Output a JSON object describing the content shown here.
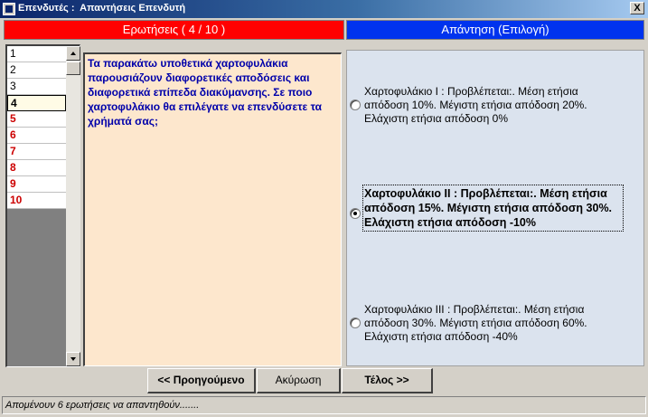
{
  "window": {
    "title": "Επενδυτές :  Απαντήσεις Επενδυτή",
    "close_label": "X"
  },
  "questions_header": "Ερωτήσεις ( 4 / 10 )",
  "answer_header": "Απάντηση (Επιλογή)",
  "question_list": [
    {
      "label": "1",
      "state": "normal"
    },
    {
      "label": "2",
      "state": "normal"
    },
    {
      "label": "3",
      "state": "normal"
    },
    {
      "label": "4",
      "state": "current"
    },
    {
      "label": "5",
      "state": "answered"
    },
    {
      "label": "6",
      "state": "answered"
    },
    {
      "label": "7",
      "state": "answered"
    },
    {
      "label": "8",
      "state": "answered"
    },
    {
      "label": "9",
      "state": "answered"
    },
    {
      "label": "10",
      "state": "answered"
    }
  ],
  "question_text": "Τα παρακάτω υποθετικά χαρτοφυλάκια παρουσιάζουν διαφορετικές αποδόσεις και διαφορετικά επίπεδα διακύμανσης. Σε ποιο χαρτοφυλάκιο θα επιλέγατε να επενδύσετε τα χρήματά σας;",
  "options": [
    {
      "text": "Χαρτοφυλάκιο I : Προβλέπεται:. Μέση ετήσια απόδοση 10%. Μέγιστη ετήσια απόδοση 20%. Ελάχιστη ετήσια απόδοση 0%",
      "selected": false
    },
    {
      "text": "Χαρτοφυλάκιο II : Προβλέπεται:. Μέση ετήσια απόδοση 15%. Μέγιστη ετήσια απόδοση 30%. Ελάχιστη ετήσια απόδοση -10%",
      "selected": true
    },
    {
      "text": "Χαρτοφυλάκιο III : Προβλέπεται:. Μέση ετήσια απόδοση 30%. Μέγιστη ετήσια απόδοση 60%. Ελάχιστη ετήσια απόδοση -40%",
      "selected": false
    }
  ],
  "buttons": {
    "previous": "<<   Προηγούμενο",
    "cancel": "Ακύρωση",
    "finish": "Τέλος >>"
  },
  "status": "Απομένουν 6 ερωτήσεις να απαντηθούν.......",
  "colors": {
    "questions_header": "#ff0000",
    "answer_header": "#0033ee",
    "answered_item": "#cc0000",
    "question_text": "#0000aa",
    "question_bg": "#fde7cd",
    "answer_bg": "#dbe3ee"
  },
  "icons": {
    "app": "app-window-icon",
    "close": "close-icon",
    "scroll_up": "arrow-up-icon",
    "scroll_down": "arrow-down-icon"
  }
}
